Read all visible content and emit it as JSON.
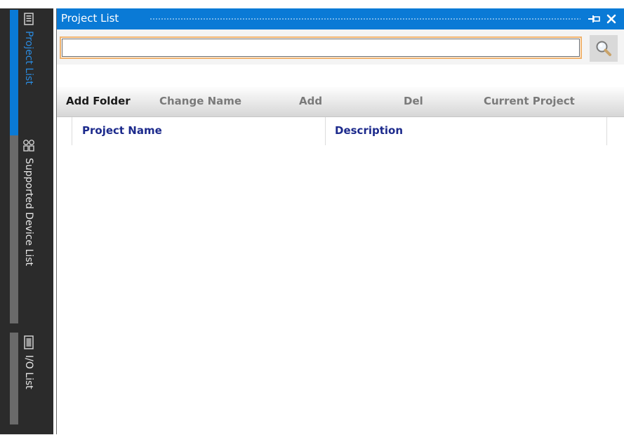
{
  "sidebar": {
    "tabs": [
      {
        "label": "Project List",
        "icon": "project-list-icon",
        "active": true
      },
      {
        "label": "Supported Device List",
        "icon": "device-list-icon",
        "active": false
      },
      {
        "label": "I/O List",
        "icon": "io-list-icon",
        "active": false
      }
    ]
  },
  "panel": {
    "title": "Project List",
    "pin_icon": "pin-icon",
    "close_icon": "close-icon"
  },
  "search": {
    "value": "",
    "placeholder": "",
    "button_icon": "search-icon"
  },
  "toolbar": {
    "add_folder": "Add Folder",
    "change_name": "Change Name",
    "add": "Add",
    "del": "Del",
    "current_project": "Current Project"
  },
  "table": {
    "columns": [
      "Project Name",
      "Description"
    ],
    "rows": []
  },
  "colors": {
    "title_bar": "#0a7ad6",
    "active_tab_accent": "#0a7ad6",
    "inactive_tab_accent": "#6a6a6a",
    "sidebar_bg": "#2b2b2b",
    "header_text": "#1c2a8c",
    "search_border": "#f0b36e"
  }
}
